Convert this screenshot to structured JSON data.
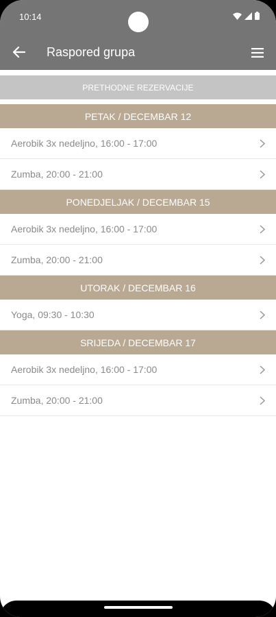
{
  "status_bar": {
    "time": "10:14",
    "icons": [
      "wifi-icon",
      "signal-icon",
      "battery-icon"
    ]
  },
  "app_bar": {
    "title": "Raspored grupa",
    "back_icon": "back-arrow-icon",
    "menu_icon": "hamburger-menu-icon"
  },
  "previous_button": {
    "label": "PRETHODNE REZERVACIJE"
  },
  "colors": {
    "app_bar": "#757575",
    "day_header": "#b9a892",
    "previous_button": "#c4c4c4",
    "row_text": "#8a8a8a"
  },
  "days": [
    {
      "header": "PETAK / DECEMBAR 12",
      "items": [
        "Aerobik 3x nedeljno, 16:00 - 17:00",
        "Zumba, 20:00 - 21:00"
      ]
    },
    {
      "header": "PONEDJELJAK / DECEMBAR 15",
      "items": [
        "Aerobik 3x nedeljno, 16:00 - 17:00",
        "Zumba, 20:00 - 21:00"
      ]
    },
    {
      "header": "UTORAK / DECEMBAR 16",
      "items": [
        "Yoga, 09:30 - 10:30"
      ]
    },
    {
      "header": "SRIJEDA / DECEMBAR 17",
      "items": [
        "Aerobik 3x nedeljno, 16:00 - 17:00",
        "Zumba, 20:00 - 21:00"
      ]
    }
  ]
}
